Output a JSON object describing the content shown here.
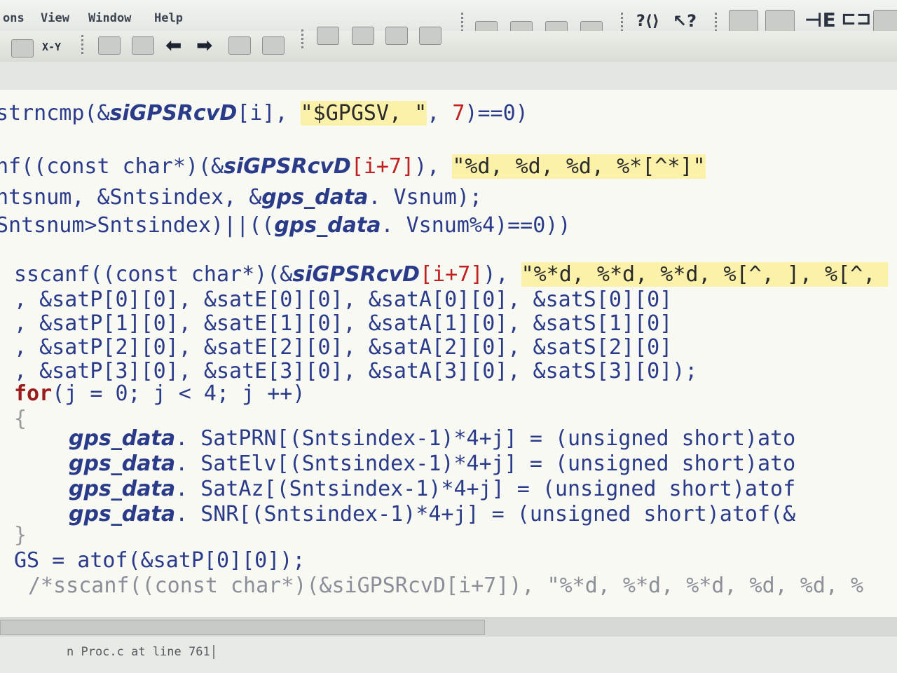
{
  "menu": {
    "items": [
      "ons",
      "View",
      "Window",
      "Help"
    ]
  },
  "toolbar": {
    "xy_label": "X-Y"
  },
  "code": {
    "line1": {
      "fn": "strncmp",
      "open": "(&",
      "var": "siGPSRcvD",
      "idx": "[i]",
      "comma": ", ",
      "str": "\"$GPGSV, \"",
      "rest1": ", ",
      "num": "7",
      "rest2": ")==0)"
    },
    "line2": {
      "prefix": "nf((const char*)(&",
      "var": "siGPSRcvD",
      "idx": "[i+7]",
      "mid": "), ",
      "str": "\"%d, %d, %d, %*[^*]\""
    },
    "line3": {
      "pre": "ntsnum, &Sntsindex, &",
      "var": "gps_data",
      "post": ". Vsnum);"
    },
    "line4": {
      "pre": "Sntsnum>Sntsindex)||((",
      "var": "gps_data",
      "post": ". Vsnum%4)==0))"
    },
    "line5": {
      "prefix": "sscanf((const char*)(&",
      "var": "siGPSRcvD",
      "idx": "[i+7]",
      "mid": "), ",
      "str": "\"%*d, %*d, %*d, %[^, ], %[^, "
    },
    "sat_rows": [
      ", &satP[0][0], &satE[0][0], &satA[0][0], &satS[0][0]",
      ", &satP[1][0], &satE[1][0], &satA[1][0], &satS[1][0]",
      ", &satP[2][0], &satE[2][0], &satA[2][0], &satS[2][0]",
      ", &satP[3][0], &satE[3][0], &satA[3][0], &satS[3][0]);"
    ],
    "for_kw": "for",
    "for_rest": "(j = 0; j < 4; j ++)",
    "brace_open": "{",
    "assignments": [
      {
        "var": "gps_data",
        "rest": ". SatPRN[(Sntsindex-1)*4+j] = (unsigned short)ato"
      },
      {
        "var": "gps_data",
        "rest": ". SatElv[(Sntsindex-1)*4+j] = (unsigned short)ato"
      },
      {
        "var": "gps_data",
        "rest": ". SatAz[(Sntsindex-1)*4+j] = (unsigned short)atof"
      },
      {
        "var": "gps_data",
        "rest": ". SNR[(Sntsindex-1)*4+j] = (unsigned short)atof(&"
      }
    ],
    "brace_close": "}",
    "gs_line": "GS = atof(&satP[0][0]);",
    "comment_line": "/*sscanf((const char*)(&siGPSRcvD[i+7]), \"%*d, %*d, %*d, %d, %d, %"
  },
  "status": {
    "text": "n Proc.c at line 761"
  }
}
